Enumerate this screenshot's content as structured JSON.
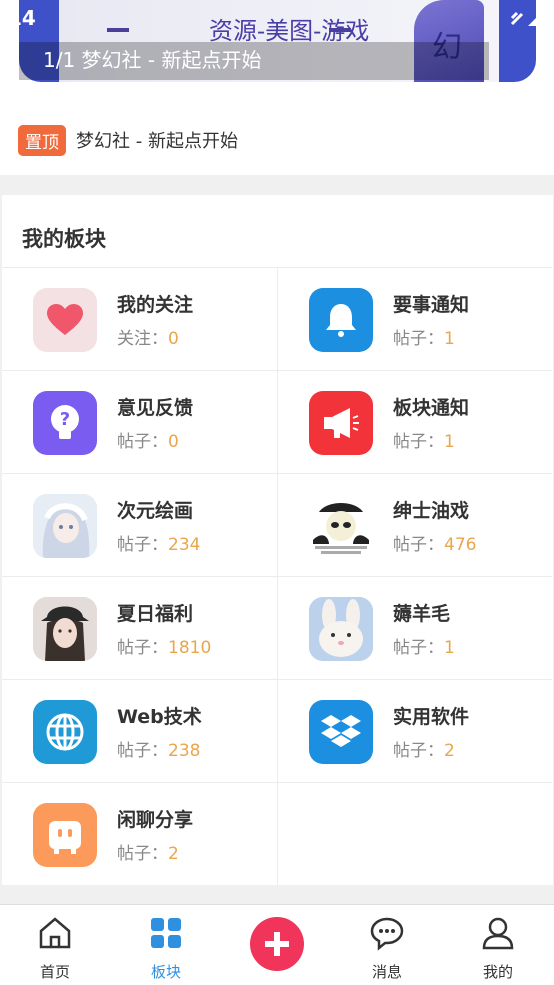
{
  "status": {
    "time": ":14"
  },
  "banner": {
    "art_text": "资源-美图-游戏",
    "art_char": "幻",
    "caption": "1/1 梦幻社 - 新起点开始"
  },
  "notice": {
    "badge": "置顶",
    "text": "梦幻社 - 新起点开始"
  },
  "section": {
    "title": "我的板块"
  },
  "boards": [
    {
      "name": "我的关注",
      "meta_label": "关注：",
      "count": "0",
      "icon": "heart-icon",
      "color": "#f3e1e3"
    },
    {
      "name": "要事通知",
      "meta_label": "帖子：",
      "count": "1",
      "icon": "bell-icon",
      "color": "#1d8fe0"
    },
    {
      "name": "意见反馈",
      "meta_label": "帖子：",
      "count": "0",
      "icon": "question-bulb-icon",
      "color": "#7b5cf0"
    },
    {
      "name": "板块通知",
      "meta_label": "帖子：",
      "count": "1",
      "icon": "megaphone-icon",
      "color": "#f2333a"
    },
    {
      "name": "次元绘画",
      "meta_label": "帖子：",
      "count": "234",
      "icon": "anime-girl-avatar",
      "color": "#dfe6ef"
    },
    {
      "name": "绅士油戏",
      "meta_label": "帖子：",
      "count": "476",
      "icon": "meme-panda-avatar",
      "color": "#ffffff"
    },
    {
      "name": "夏日福利",
      "meta_label": "帖子：",
      "count": "1810",
      "icon": "girl-photo-avatar",
      "color": "#d8d0cc"
    },
    {
      "name": "薅羊毛",
      "meta_label": "帖子：",
      "count": "1",
      "icon": "rabbit-avatar",
      "color": "#b9cfe9"
    },
    {
      "name": "Web技术",
      "meta_label": "帖子：",
      "count": "238",
      "icon": "globe-icon",
      "color": "#1f9ad6"
    },
    {
      "name": "实用软件",
      "meta_label": "帖子：",
      "count": "2",
      "icon": "dropbox-icon",
      "color": "#1d8fe0"
    },
    {
      "name": "闲聊分享",
      "meta_label": "帖子：",
      "count": "2",
      "icon": "chat-bag-icon",
      "color": "#fb9a5a"
    }
  ],
  "tabbar": {
    "home": "首页",
    "boards": "板块",
    "messages": "消息",
    "mine": "我的"
  }
}
